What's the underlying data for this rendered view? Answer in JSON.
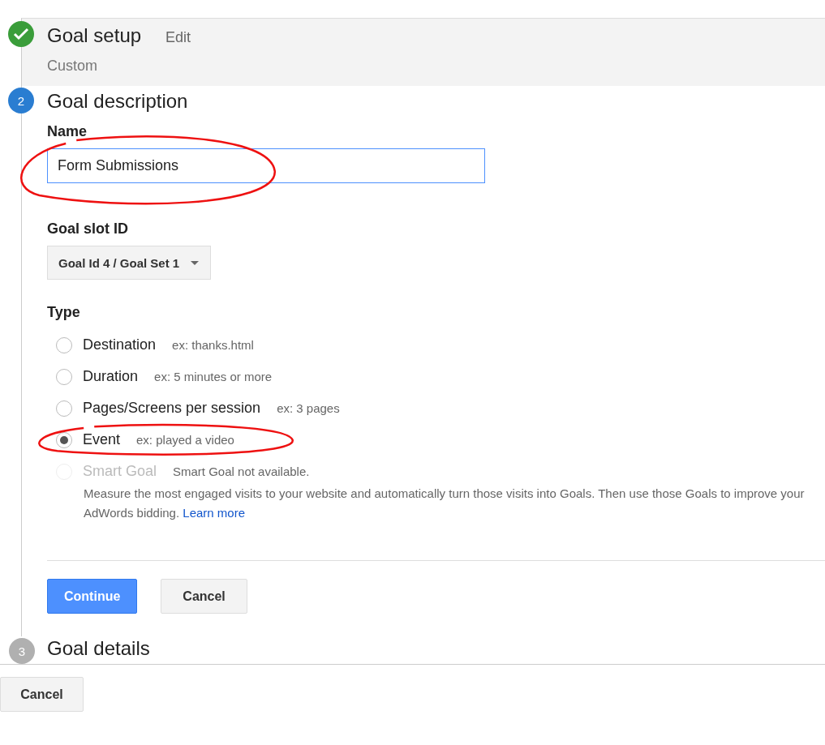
{
  "steps": [
    {
      "kind": "done",
      "title": "Goal setup",
      "action": "Edit",
      "summary": "Custom"
    },
    {
      "kind": "active",
      "number": "2",
      "title": "Goal description"
    },
    {
      "kind": "pending",
      "number": "3",
      "title": "Goal details"
    }
  ],
  "name_field": {
    "label": "Name",
    "value": "Form Submissions",
    "focused": true,
    "circled": true
  },
  "goal_slot": {
    "label": "Goal slot ID",
    "value": "Goal Id 4 / Goal Set 1"
  },
  "type": {
    "label": "Type",
    "options": [
      {
        "label": "Destination",
        "hint": "ex: thanks.html",
        "selected": false,
        "disabled": false,
        "circled": false
      },
      {
        "label": "Duration",
        "hint": "ex: 5 minutes or more",
        "selected": false,
        "disabled": false,
        "circled": false
      },
      {
        "label": "Pages/Screens per session",
        "hint": "ex: 3 pages",
        "selected": false,
        "disabled": false,
        "circled": false
      },
      {
        "label": "Event",
        "hint": "ex: played a video",
        "selected": true,
        "disabled": false,
        "circled": true
      },
      {
        "label": "Smart Goal",
        "hint": "Smart Goal not available.",
        "selected": false,
        "disabled": true,
        "circled": false,
        "description": "Measure the most engaged visits to your website and automatically turn those visits into Goals. Then use those Goals to improve your AdWords bidding.",
        "link": "Learn more"
      }
    ]
  },
  "buttons": [
    {
      "label": "Continue",
      "kind": "primary"
    },
    {
      "label": "Cancel",
      "kind": "secondary"
    }
  ],
  "footer_button": "Cancel"
}
